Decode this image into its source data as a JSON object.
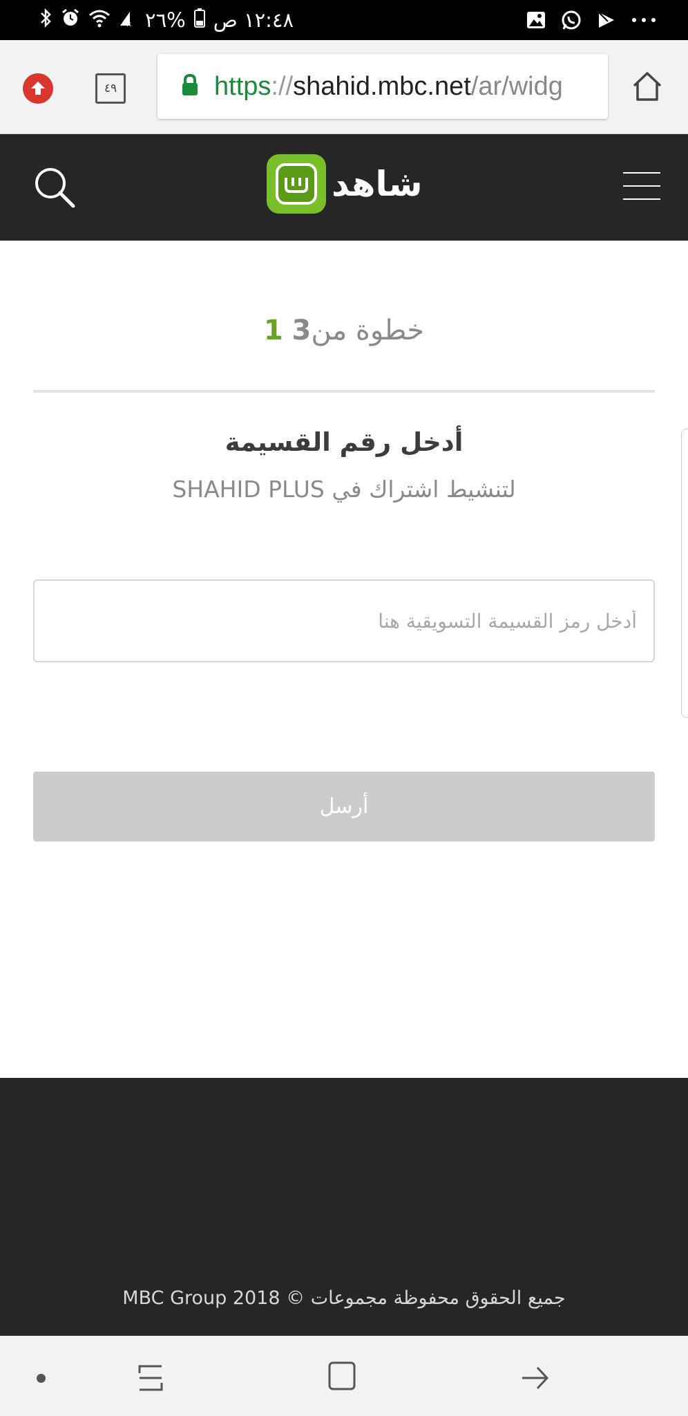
{
  "status_bar": {
    "time": "١٢:٤٨ ص",
    "battery": "%٢٦"
  },
  "browser": {
    "tab_count": "٤٩",
    "url": {
      "scheme": "https",
      "separator": "://",
      "host": "shahid.mbc.net",
      "path": "/ar/widg"
    }
  },
  "header": {
    "logo_text": "شاهد"
  },
  "stepper": {
    "label": "خطوة من",
    "current": "1",
    "total": "3",
    "progress": 0
  },
  "form": {
    "heading": "أدخل رقم القسيمة",
    "subheading": "لتنشيط اشتراك في SHAHID PLUS",
    "voucher_placeholder": "أدخل رمز القسيمة التسويقية هنا",
    "voucher_value": "",
    "submit_label": "أرسل"
  },
  "footer": {
    "copyright": "جميع الحقوق محفوظة مجموعات © MBC Group 2018"
  },
  "colors": {
    "brand_green": "#78bf2a",
    "header_bg": "#262626",
    "button_disabled": "#cccccc"
  }
}
